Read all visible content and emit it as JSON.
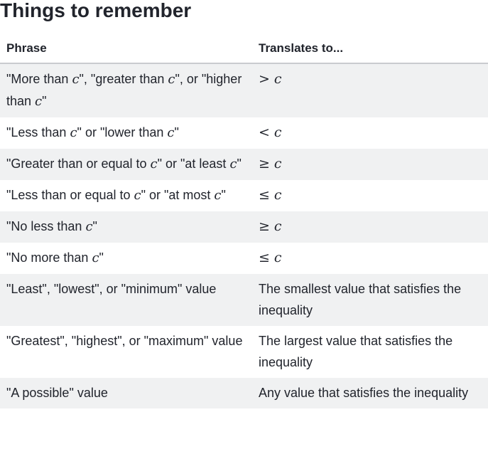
{
  "title": "Things to remember",
  "table": {
    "headers": [
      "Phrase",
      "Translates to..."
    ],
    "variable": "c",
    "rows": [
      {
        "phrase": [
          "\"More than ",
          "\", \"greater than ",
          "\", or \"higher than ",
          "\""
        ],
        "translation_symbol": ">"
      },
      {
        "phrase": [
          "\"Less than ",
          "\" or \"lower than ",
          "\""
        ],
        "translation_symbol": "<"
      },
      {
        "phrase": [
          "\"Greater than or equal to ",
          "\" or \"at least ",
          "\""
        ],
        "translation_symbol": "≥"
      },
      {
        "phrase": [
          "\"Less than or equal to ",
          "\" or \"at most ",
          "\""
        ],
        "translation_symbol": "≤"
      },
      {
        "phrase": [
          "\"No less than ",
          "\""
        ],
        "translation_symbol": "≥"
      },
      {
        "phrase": [
          "\"No more than ",
          "\""
        ],
        "translation_symbol": "≤"
      },
      {
        "phrase": [
          "\"Least\", \"lowest\", or \"minimum\" value"
        ],
        "translation_text": "The smallest value that satisfies the inequality"
      },
      {
        "phrase": [
          "\"Greatest\", \"highest\", or \"maximum\" value"
        ],
        "translation_text": "The largest value that satisfies the inequality"
      },
      {
        "phrase": [
          "\"A possible\" value"
        ],
        "translation_text": "Any value that satisfies the inequality"
      }
    ]
  }
}
